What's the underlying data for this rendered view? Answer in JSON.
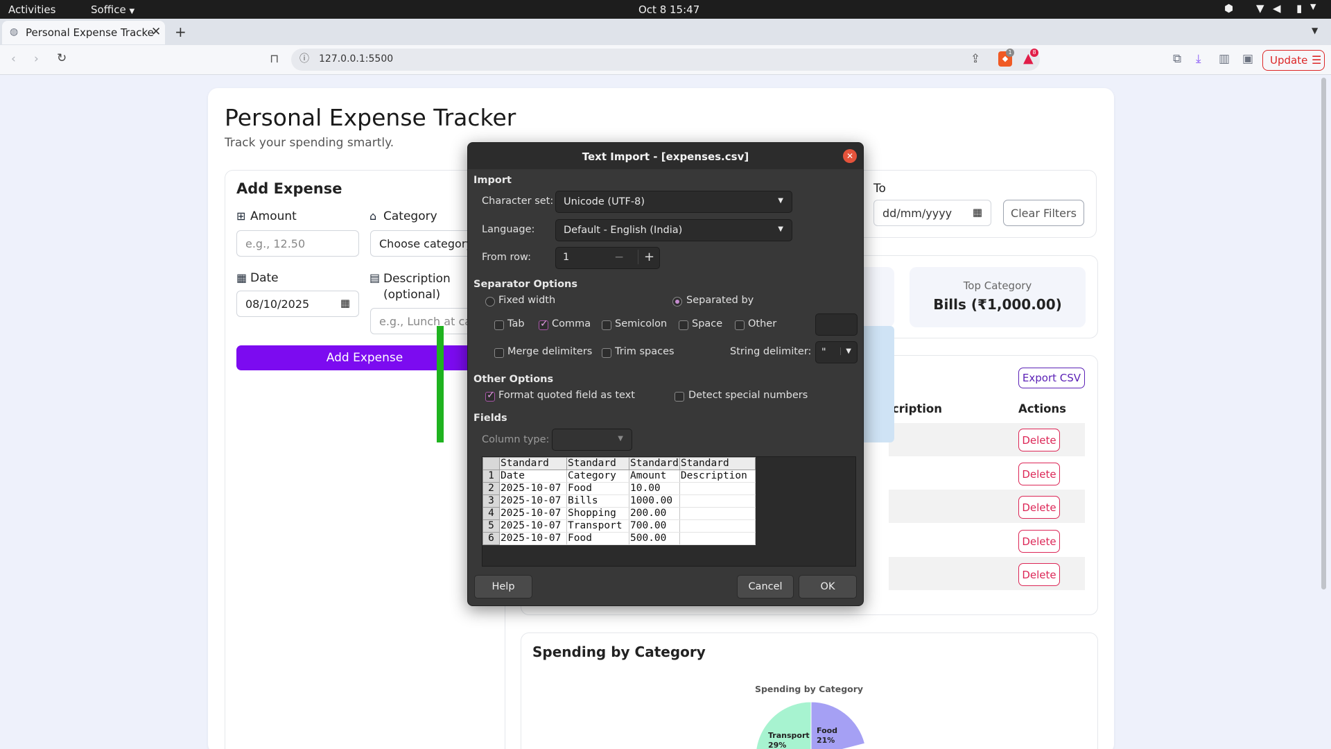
{
  "system": {
    "activities": "Activities",
    "app": "Soffice",
    "clock": "Oct 8  15:47"
  },
  "browser": {
    "tab_title": "Personal Expense Tracke",
    "url": "127.0.0.1:5500",
    "update_label": "Update",
    "brave_badge": "1",
    "alert_badge": "8"
  },
  "page": {
    "title": "Personal Expense Tracker",
    "subtitle": "Track your spending smartly.",
    "add_expense": {
      "heading": "Add Expense",
      "amount_label": "Amount",
      "amount_placeholder": "e.g., 12.50",
      "category_label": "Category",
      "category_value": "Choose category",
      "date_label": "Date",
      "date_value": "08/10/2025",
      "description_label": "Description (optional)",
      "description_placeholder": "e.g., Lunch at ca",
      "button": "Add Expense"
    },
    "filters": {
      "to_label": "To",
      "to_placeholder": "dd/mm/yyyy",
      "clear_button": "Clear Filters"
    },
    "stats": {
      "top_category_label": "Top Category",
      "top_category_value": "Bills (₹1,000.00)"
    },
    "table": {
      "export_button": "Export CSV",
      "col_description": "cription",
      "col_actions": "Actions",
      "delete_label": "Delete"
    },
    "chart": {
      "heading": "Spending by Category",
      "title": "Spending by Category",
      "slices": [
        {
          "label": "Transport",
          "pct": "29%",
          "color": "#a7f3d0"
        },
        {
          "label": "Food",
          "pct": "21%",
          "color": "#a5a0f4"
        }
      ]
    }
  },
  "dialog": {
    "title": "Text Import - [expenses.csv]",
    "import_section": "Import",
    "charset_label": "Character set:",
    "charset_value": "Unicode (UTF-8)",
    "language_label": "Language:",
    "language_value": "Default - English (India)",
    "from_row_label": "From row:",
    "from_row_value": "1",
    "separator_section": "Separator Options",
    "fixed_width": "Fixed width",
    "separated_by": "Separated by",
    "tab": "Tab",
    "comma": "Comma",
    "semicolon": "Semicolon",
    "space": "Space",
    "other": "Other",
    "merge_delimiters": "Merge delimiters",
    "trim_spaces": "Trim spaces",
    "string_delimiter_label": "String delimiter:",
    "string_delimiter_value": "\"",
    "other_section": "Other Options",
    "format_quoted": "Format quoted field as text",
    "detect_special": "Detect special numbers",
    "fields_section": "Fields",
    "column_type_label": "Column type:",
    "preview": {
      "headers": [
        "Standard",
        "Standard",
        "Standard",
        "Standard"
      ],
      "rows": [
        [
          "1",
          "Date",
          "Category",
          "Amount",
          "Description"
        ],
        [
          "2",
          "2025-10-07",
          "Food",
          "10.00",
          ""
        ],
        [
          "3",
          "2025-10-07",
          "Bills",
          "1000.00",
          ""
        ],
        [
          "4",
          "2025-10-07",
          "Shopping",
          "200.00",
          ""
        ],
        [
          "5",
          "2025-10-07",
          "Transport",
          "700.00",
          ""
        ],
        [
          "6",
          "2025-10-07",
          "Food",
          "500.00",
          ""
        ]
      ]
    },
    "help": "Help",
    "cancel": "Cancel",
    "ok": "OK"
  }
}
